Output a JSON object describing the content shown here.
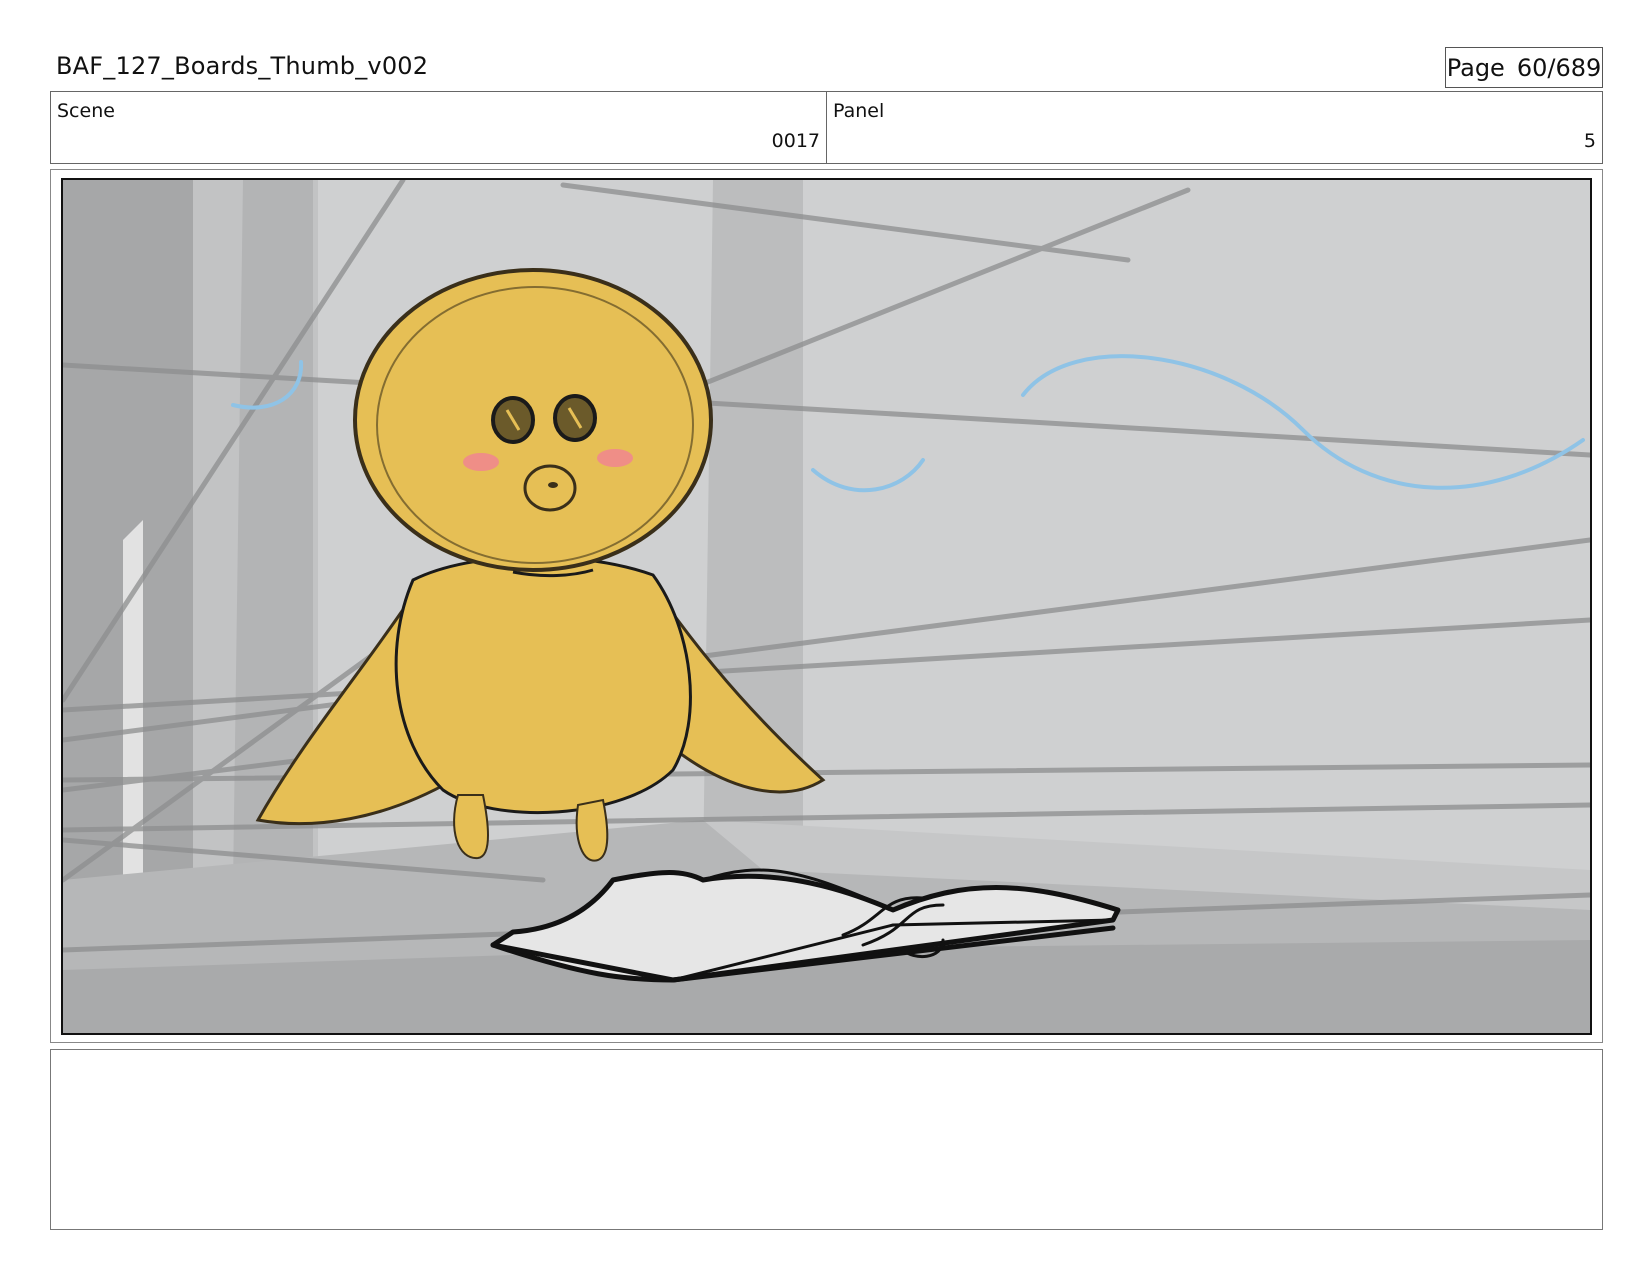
{
  "header": {
    "title": "BAF_127_Boards_Thumb_v002",
    "page_label": "Page",
    "page_value": "60/689"
  },
  "info": {
    "scene_label": "Scene",
    "scene_value": "0017",
    "panel_label": "Panel",
    "panel_value": "5"
  },
  "frame": {
    "description_visible": false
  },
  "colors": {
    "bird_yellow": "#e6bf55",
    "cheek_pink": "#ef8e87",
    "wind_blue": "#8fc3e6",
    "background_gray": "#cfd0d1"
  },
  "notes": {
    "text": ""
  }
}
